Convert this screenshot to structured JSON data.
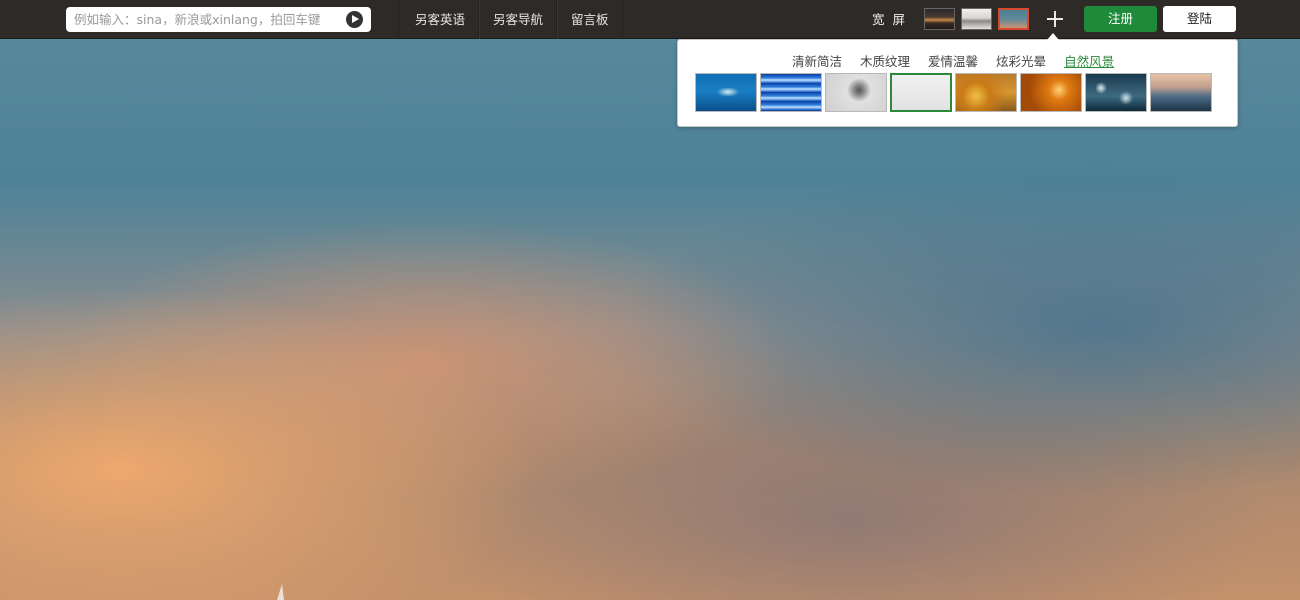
{
  "search": {
    "placeholder": "例如输入：sina，新浪或xinlang，拍回车键"
  },
  "nav": {
    "items": [
      "另客英语",
      "另客导航",
      "留言板"
    ]
  },
  "header": {
    "wide_label": "宽 屏",
    "register_label": "注册",
    "login_label": "登陆"
  },
  "skin_panel": {
    "tabs": [
      "清新简洁",
      "木质纹理",
      "爱情温馨",
      "炫彩光晕",
      "自然风景"
    ],
    "active_tab": "自然风景",
    "thumbnail_count": 8,
    "selected_index": 3
  },
  "theme_thumbs": {
    "active_index": 2
  },
  "colors": {
    "topbar": "#2e2a27",
    "register_button": "#1f8a3a",
    "active_tab": "#2a8a3a",
    "active_theme_border": "#d84a2e"
  }
}
